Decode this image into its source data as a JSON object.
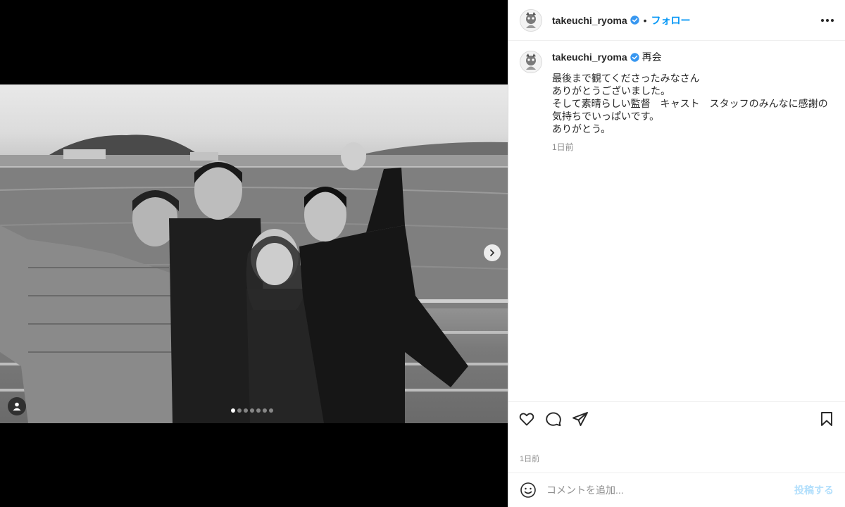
{
  "post": {
    "username": "takeuchi_ryoma",
    "separator": "•",
    "follow_label": "フォロー",
    "caption_title": "再会",
    "caption_text": "最後まで観てくださったみなさん\nありがとうございました。\nそして素晴らしい監督　キャスト　スタッフのみんなに感謝の気持ちでいっぱいです。\nありがとう。",
    "caption_time": "1日前",
    "post_time": "1日前"
  },
  "comment_box": {
    "placeholder": "コメントを追加...",
    "post_label": "投稿する"
  },
  "carousel": {
    "total": 7,
    "active_index": 0
  },
  "colors": {
    "accent": "#0095f6",
    "verified": "#3897f0",
    "post_disabled": "#b2dffc"
  },
  "icons": [
    "more-icon",
    "verified-icon",
    "heart-icon",
    "comment-icon",
    "share-icon",
    "bookmark-icon",
    "emoji-icon",
    "chevron-right-icon",
    "user-tag-icon"
  ]
}
